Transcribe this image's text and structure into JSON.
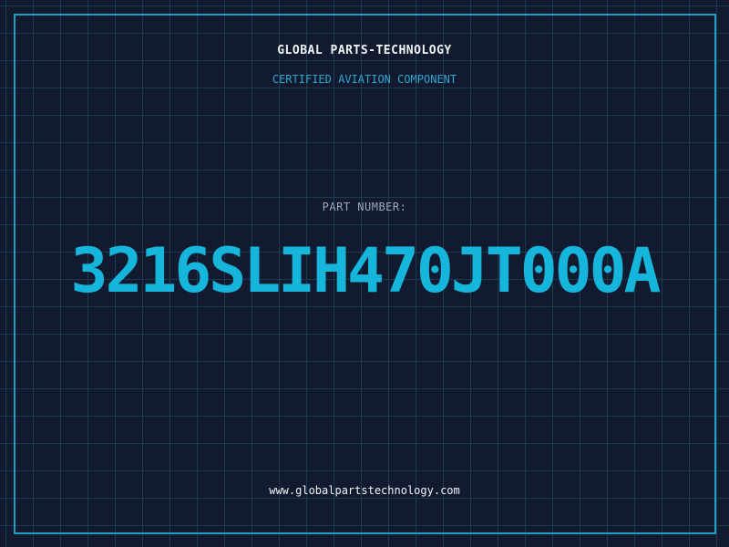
{
  "header": {
    "company": "GLOBAL PARTS-TECHNOLOGY",
    "subtitle": "CERTIFIED AVIATION COMPONENT"
  },
  "part": {
    "label": "PART NUMBER:",
    "number": "3216SLIH470JT000A"
  },
  "footer": {
    "website": "www.globalpartstechnology.com"
  },
  "colors": {
    "background": "#111a2e",
    "grid": "#1e3a52",
    "accent": "#16b6dc",
    "text": "#f2f4f7"
  }
}
